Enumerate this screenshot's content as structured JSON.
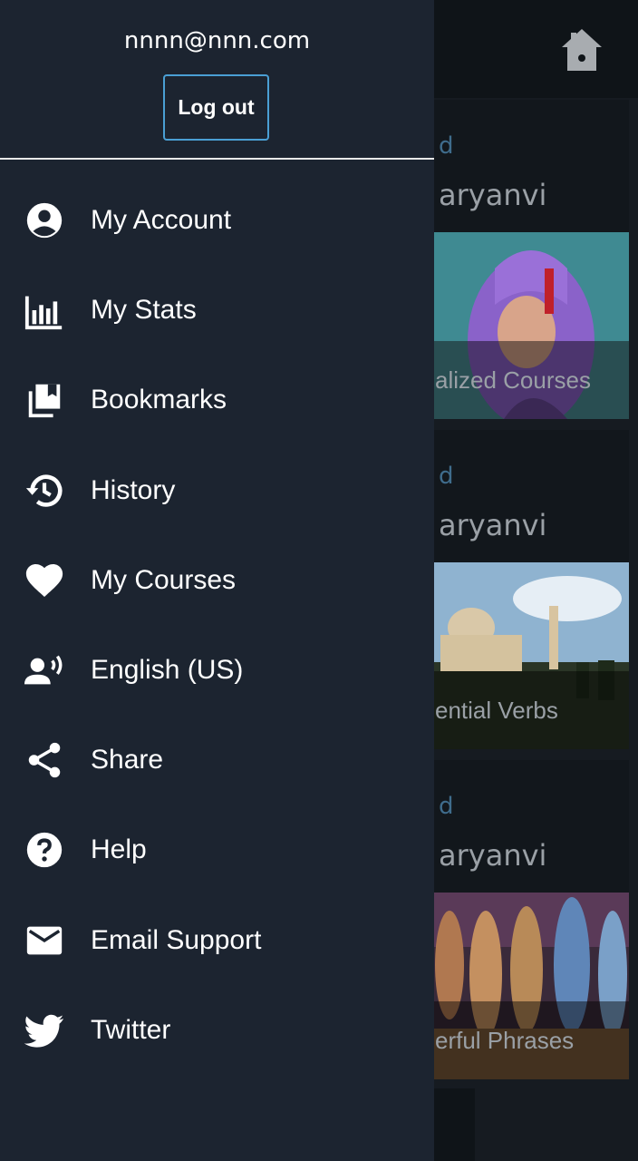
{
  "header": {
    "email": "nnnn@nnn.com",
    "logout_label": "Log out"
  },
  "menu": [
    {
      "label": "My Account",
      "icon": "account-circle-icon"
    },
    {
      "label": "My Stats",
      "icon": "stats-bar-chart-icon"
    },
    {
      "label": "Bookmarks",
      "icon": "bookmarks-icon"
    },
    {
      "label": "History",
      "icon": "history-icon"
    },
    {
      "label": "My Courses",
      "icon": "heart-icon"
    },
    {
      "label": "English (US)",
      "icon": "voice-language-icon"
    },
    {
      "label": "Share",
      "icon": "share-icon"
    },
    {
      "label": "Help",
      "icon": "help-icon"
    },
    {
      "label": "Email Support",
      "icon": "email-icon"
    },
    {
      "label": "Twitter",
      "icon": "twitter-icon"
    }
  ],
  "background": {
    "home_icon": "home-icon",
    "cards": [
      {
        "kicker": "d",
        "lang": "aryanvi",
        "caption": "alized Courses"
      },
      {
        "kicker": "d",
        "lang": "aryanvi",
        "caption": "ential Verbs"
      },
      {
        "kicker": "d",
        "lang": "aryanvi",
        "caption": "erful Phrases"
      }
    ]
  },
  "colors": {
    "drawer_bg": "#1c2430",
    "accent_border": "#4a9fd4",
    "text": "#ffffff"
  }
}
